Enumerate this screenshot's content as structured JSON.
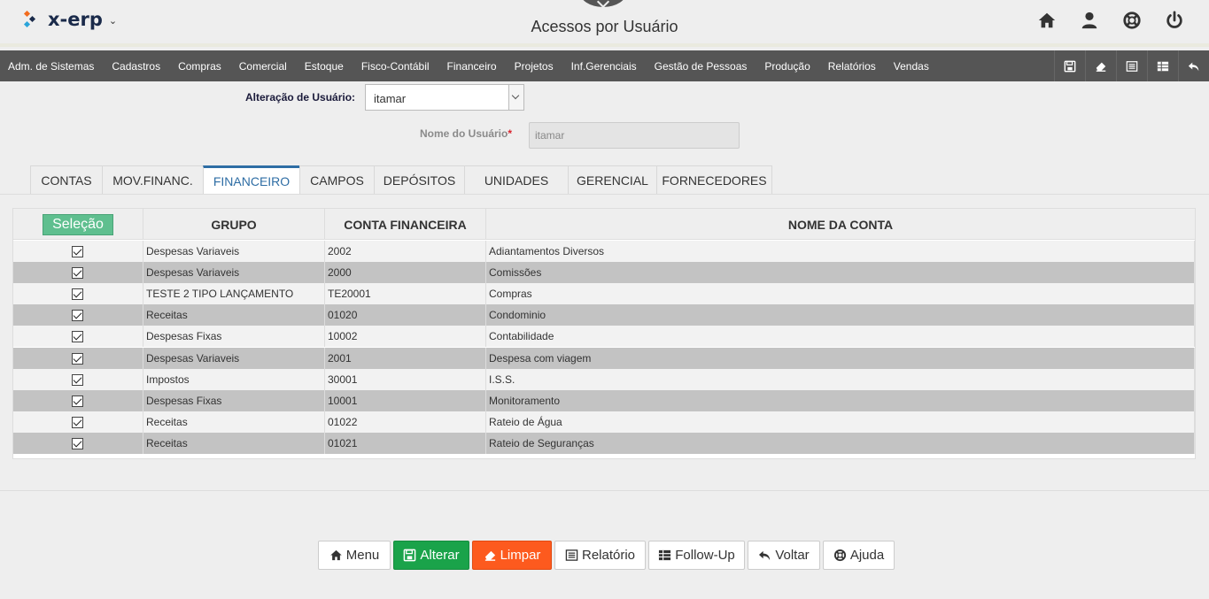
{
  "header": {
    "logo_text": "x-erp",
    "logo_caret": "⌄",
    "title": "Acessos por Usuário"
  },
  "menu": {
    "items": [
      "Adm. de Sistemas",
      "Cadastros",
      "Compras",
      "Comercial",
      "Estoque",
      "Fisco-Contábil",
      "Financeiro",
      "Projetos",
      "Inf.Gerenciais",
      "Gestão de Pessoas",
      "Produção",
      "Relatórios",
      "Vendas"
    ]
  },
  "form": {
    "user_label": "Alteração de Usuário:",
    "user_value": "itamar",
    "name_label": "Nome do Usuário",
    "required_mark": "*",
    "name_value": "itamar"
  },
  "tabs": [
    "CONTAS",
    "MOV.FINANC.",
    "FINANCEIRO",
    "CAMPOS",
    "DEPÓSITOS",
    "UNIDADES",
    "GERENCIAL",
    "FORNECEDORES"
  ],
  "active_tab": "FINANCEIRO",
  "table": {
    "select_label": "Seleção",
    "columns": [
      "GRUPO",
      "CONTA FINANCEIRA",
      "NOME DA CONTA"
    ],
    "rows": [
      {
        "checked": true,
        "grupo": "Despesas Variaveis",
        "conta": "2002",
        "nome": "Adiantamentos Diversos"
      },
      {
        "checked": true,
        "grupo": "Despesas Variaveis",
        "conta": "2000",
        "nome": "Comissões"
      },
      {
        "checked": true,
        "grupo": "TESTE 2 TIPO LANÇAMENTO",
        "conta": "TE20001",
        "nome": "Compras"
      },
      {
        "checked": true,
        "grupo": "Receitas",
        "conta": "01020",
        "nome": "Condominio"
      },
      {
        "checked": true,
        "grupo": "Despesas Fixas",
        "conta": "10002",
        "nome": "Contabilidade"
      },
      {
        "checked": true,
        "grupo": "Despesas Variaveis",
        "conta": "2001",
        "nome": "Despesa com viagem"
      },
      {
        "checked": true,
        "grupo": "Impostos",
        "conta": "30001",
        "nome": "I.S.S."
      },
      {
        "checked": true,
        "grupo": "Despesas Fixas",
        "conta": "10001",
        "nome": "Monitoramento"
      },
      {
        "checked": true,
        "grupo": "Receitas",
        "conta": "01022",
        "nome": "Rateio de Água"
      },
      {
        "checked": true,
        "grupo": "Receitas",
        "conta": "01021",
        "nome": "Rateio de Seguranças"
      }
    ]
  },
  "buttons": {
    "menu": "Menu",
    "alterar": "Alterar",
    "limpar": "Limpar",
    "relatorio": "Relatório",
    "followup": "Follow-Up",
    "voltar": "Voltar",
    "ajuda": "Ajuda"
  },
  "colors": {
    "menubar": "#555555",
    "active_tab": "#2e6da4",
    "alterar": "#1aa34a",
    "limpar": "#fd5a1e",
    "selecao": "#5fbf8f",
    "row_alt": "#c3c3c3"
  },
  "icons": {
    "header": [
      "home-icon",
      "user-icon",
      "lifebuoy-icon",
      "power-icon"
    ],
    "toolbar": [
      "save-icon",
      "eraser-icon",
      "list-icon",
      "table-icon",
      "undo-icon"
    ]
  }
}
